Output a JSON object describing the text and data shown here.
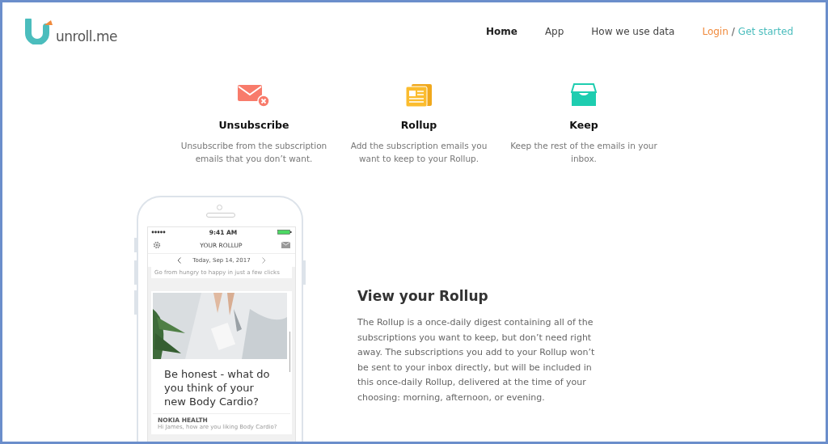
{
  "logo": {
    "text": "unroll.me"
  },
  "nav": [
    {
      "label": "Home",
      "selected": true
    },
    {
      "label": "App",
      "selected": false
    },
    {
      "label": "How we use data",
      "selected": false
    }
  ],
  "auth": {
    "login": "Login",
    "separator": "/",
    "signup": "Get started"
  },
  "features": [
    {
      "kind": "unsubscribe",
      "title": "Unsubscribe",
      "text": "Unsubscribe from the subscription emails that you don’t want."
    },
    {
      "kind": "rollup",
      "title": "Rollup",
      "text": "Add the subscription emails you want to keep to your Rollup."
    },
    {
      "kind": "keep",
      "title": "Keep",
      "text": "Keep the rest of the emails in your inbox."
    }
  ],
  "phone": {
    "time": "9:41 AM",
    "title": "YOUR ROLLUP",
    "date": "Today, Sep 14, 2017",
    "snippet": "Go from hungry to happy in just a few clicks",
    "card": {
      "headline": "Be honest - what do you think of your new Body Cardio?",
      "sender": "NOKIA HEALTH",
      "preview": "Hi James, how are you liking Body Cardio?"
    }
  },
  "section": {
    "title": "View your Rollup",
    "text": "The Rollup is a once-daily digest containing all of the subscriptions you want to keep, but don’t need right away. The subscriptions you add to your Rollup won’t be sent to your inbox directly, but will be included in this once-daily Rollup, delivered at the time of your choosing: morning, afternoon, or evening."
  }
}
